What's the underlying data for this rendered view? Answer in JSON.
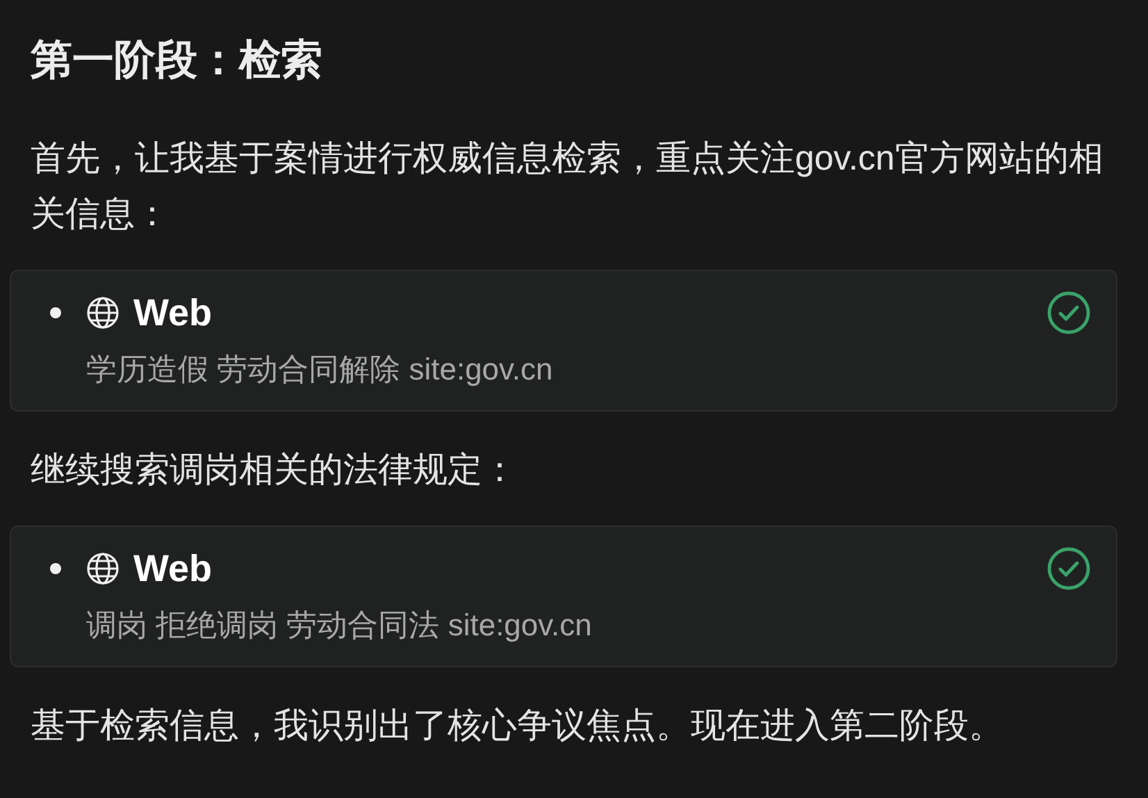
{
  "blocks": [
    {
      "kind": "heading",
      "text": "第一阶段：检索"
    },
    {
      "kind": "paragraph",
      "text": "首先，让我基于案情进行权威信息检索，重点关注gov.cn官方网站的相关信息："
    },
    {
      "kind": "tool",
      "name": "Web",
      "query": "学历造假 劳动合同解除 site:gov.cn",
      "done": true
    },
    {
      "kind": "paragraph",
      "text": "继续搜索调岗相关的法律规定："
    },
    {
      "kind": "tool",
      "name": "Web",
      "query": "调岗 拒绝调岗 劳动合同法 site:gov.cn",
      "done": true
    },
    {
      "kind": "paragraph",
      "text": "基于检索信息，我识别出了核心争议焦点。现在进入第二阶段。"
    }
  ]
}
